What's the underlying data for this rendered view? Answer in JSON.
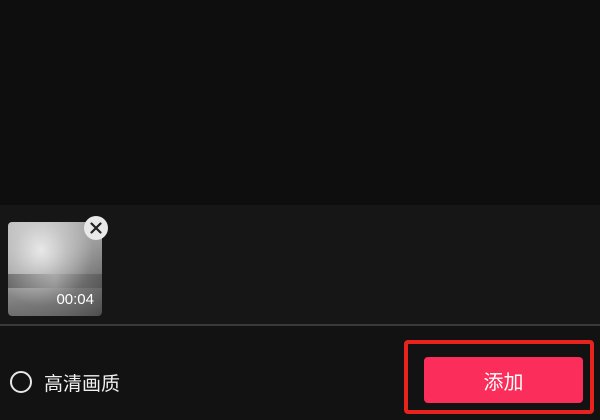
{
  "preview": {},
  "selection": {
    "clips": [
      {
        "duration": "00:04",
        "remove_icon": "close-icon"
      }
    ]
  },
  "footer": {
    "hd_option_label": "高清画质",
    "hd_option_checked": false,
    "add_button_label": "添加"
  },
  "colors": {
    "background": "#0f0f0f",
    "tray": "#161616",
    "accent": "#fb2d5a",
    "highlight_frame": "#e8231d"
  }
}
